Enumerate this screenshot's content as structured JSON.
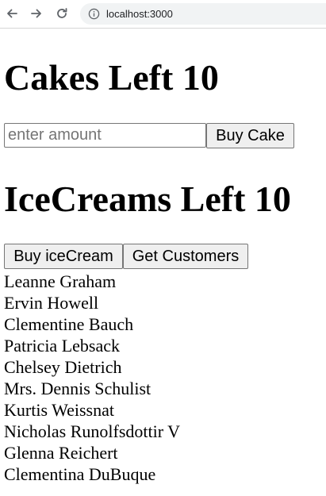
{
  "browser": {
    "url": "localhost:3000",
    "icons": {
      "back": "arrow-left-icon",
      "forward": "arrow-right-icon",
      "reload": "reload-icon",
      "site_info": "info-icon"
    }
  },
  "cakes": {
    "heading": "Cakes Left 10",
    "amount_placeholder": "enter amount",
    "amount_value": "",
    "buy_label": "Buy Cake"
  },
  "icecreams": {
    "heading": "IceCreams Left 10",
    "buy_label": "Buy iceCream",
    "get_customers_label": "Get Customers"
  },
  "customers": [
    "Leanne Graham",
    "Ervin Howell",
    "Clementine Bauch",
    "Patricia Lebsack",
    "Chelsey Dietrich",
    "Mrs. Dennis Schulist",
    "Kurtis Weissnat",
    "Nicholas Runolfsdottir V",
    "Glenna Reichert",
    "Clementina DuBuque"
  ]
}
